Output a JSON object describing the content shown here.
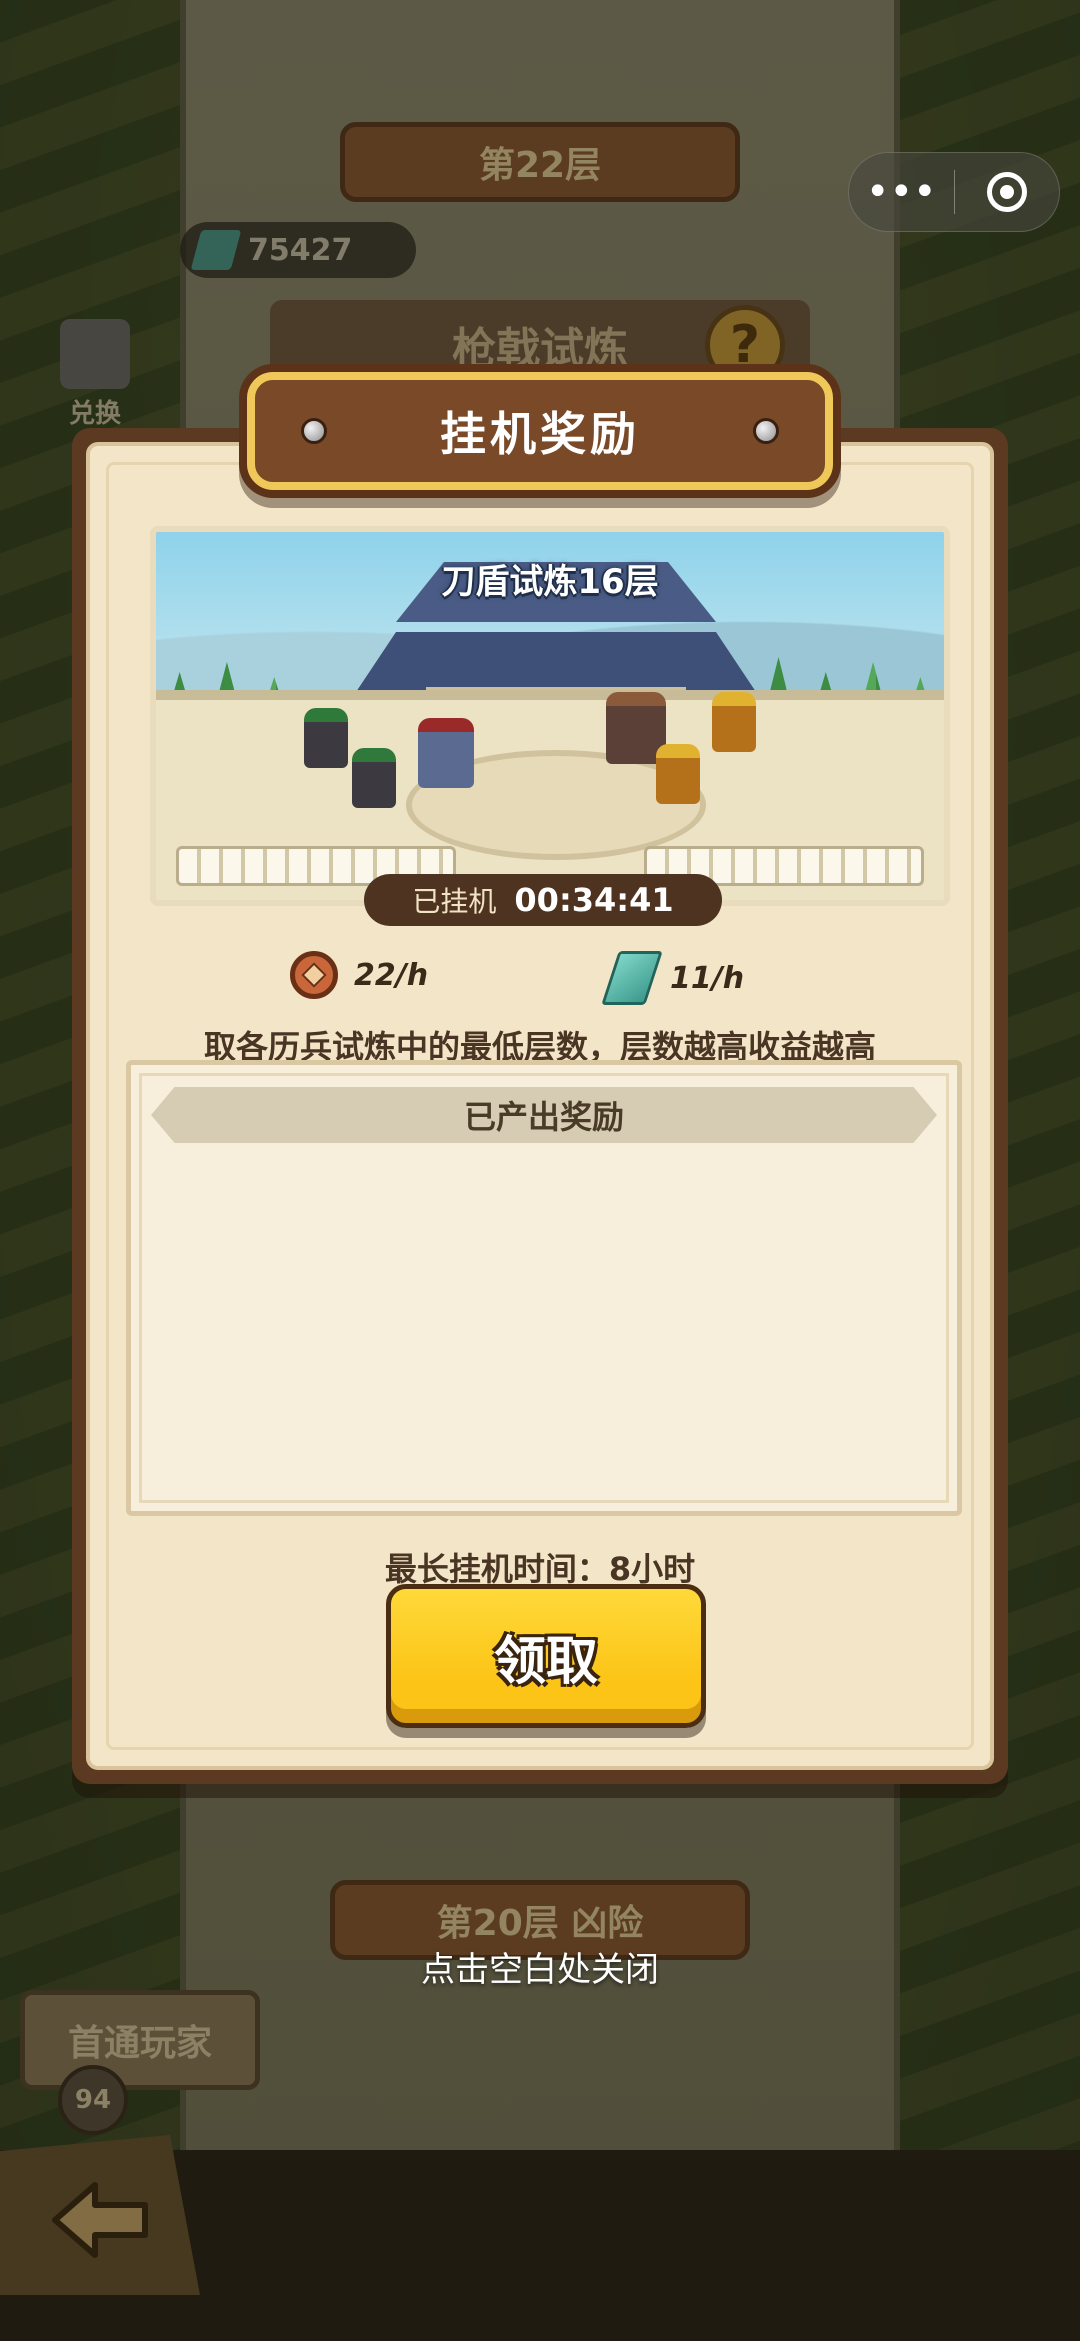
{
  "background": {
    "top_floor_label": "第22层",
    "bottom_floor_label": "第20层 凶险",
    "currency_value": "75427",
    "subtitle": "枪戟试炼",
    "exchange_label": "兑换",
    "first_clear_label": "首通玩家",
    "first_clear_count": "94"
  },
  "capsule": {
    "more_glyph": "•••"
  },
  "dialog": {
    "title": "挂机奖励",
    "scene_label": "刀盾试炼16层",
    "timer_label": "已挂机",
    "timer_value": "00:34:41",
    "coin_rate": "22/h",
    "jade_rate": "11/h",
    "hint": "取各历兵试炼中的最低层数，层数越高收益越高",
    "rewards_header": "已产出奖励",
    "max_time": "最长挂机时间：8小时",
    "claim_label": "领取"
  },
  "close_hint": "点击空白处关闭",
  "colors": {
    "frame": "#5c3a22",
    "parchment": "#f3e6c8",
    "button": "#fcc416",
    "title_border": "#f0c85a"
  },
  "icons": [
    "more-icon",
    "target-icon",
    "coin-icon",
    "jade-icon",
    "back-arrow-icon",
    "question-icon",
    "gem-icon"
  ]
}
